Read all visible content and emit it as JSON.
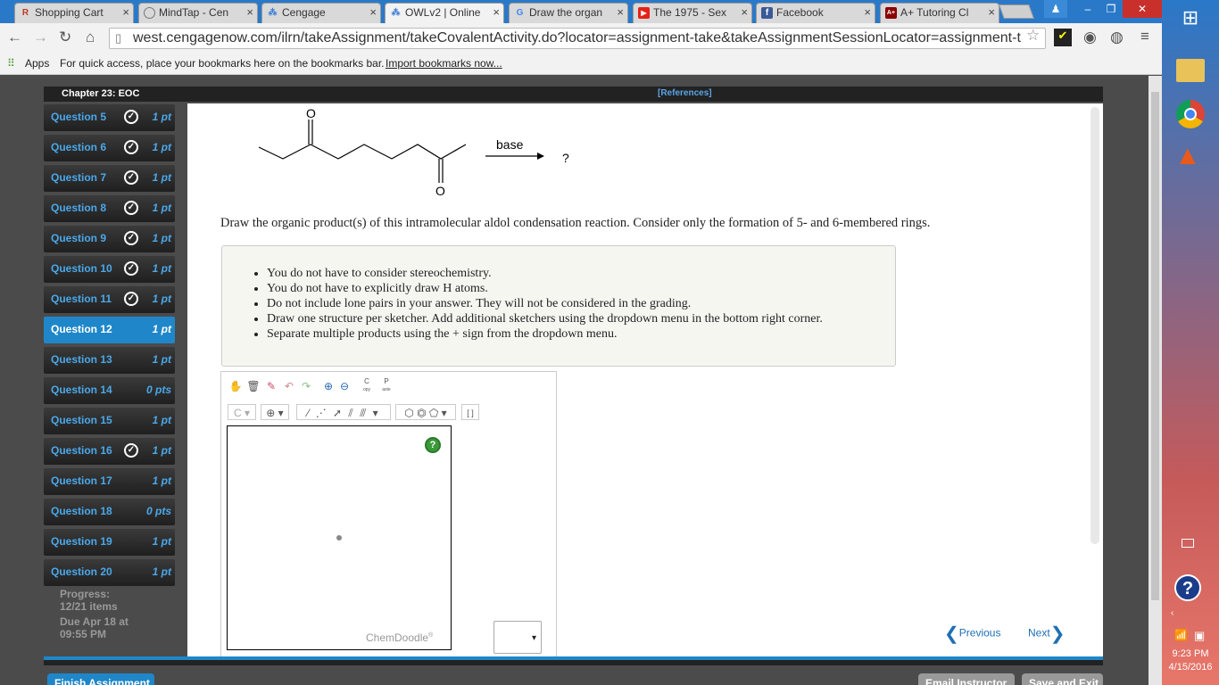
{
  "tabs": [
    {
      "label": "Shopping Cart",
      "icon": "R",
      "color": "#c0392b"
    },
    {
      "label": "MindTap - Cen",
      "icon": "mindtap-icon",
      "color": "#555"
    },
    {
      "label": "Cengage",
      "icon": "cengage-icon",
      "color": "#3a7bd5"
    },
    {
      "label": "OWLv2 | Online",
      "icon": "owl-icon",
      "color": "#3a7bd5"
    },
    {
      "label": "Draw the organ",
      "icon": "G",
      "color": "#4285f4"
    },
    {
      "label": "The 1975 - Sex",
      "icon": "youtube-icon",
      "color": "#e62117"
    },
    {
      "label": "Facebook",
      "icon": "f",
      "color": "#3b5998"
    },
    {
      "label": "A+ Tutoring Cl",
      "icon": "A+",
      "color": "#8b0000"
    }
  ],
  "url": "west.cengagenow.com/ilrn/takeAssignment/takeCovalentActivity.do?locator=assignment-take&takeAssignmentSessionLocator=assignment-t",
  "bookmarks": {
    "apps": "Apps",
    "hint": "For quick access, place your bookmarks here on the bookmarks bar.",
    "import": "Import bookmarks now..."
  },
  "chapter": {
    "title": "Chapter 23: EOC",
    "references": "[References]"
  },
  "questions": [
    {
      "label": "Question 5",
      "points": "1 pt",
      "done": true
    },
    {
      "label": "Question 6",
      "points": "1 pt",
      "done": true
    },
    {
      "label": "Question 7",
      "points": "1 pt",
      "done": true
    },
    {
      "label": "Question 8",
      "points": "1 pt",
      "done": true
    },
    {
      "label": "Question 9",
      "points": "1 pt",
      "done": true
    },
    {
      "label": "Question 10",
      "points": "1 pt",
      "done": true
    },
    {
      "label": "Question 11",
      "points": "1 pt",
      "done": true
    },
    {
      "label": "Question 12",
      "points": "1 pt",
      "done": false,
      "current": true
    },
    {
      "label": "Question 13",
      "points": "1 pt",
      "done": false
    },
    {
      "label": "Question 14",
      "points": "0 pts",
      "done": false
    },
    {
      "label": "Question 15",
      "points": "1 pt",
      "done": false
    },
    {
      "label": "Question 16",
      "points": "1 pt",
      "done": true
    },
    {
      "label": "Question 17",
      "points": "1 pt",
      "done": false
    },
    {
      "label": "Question 18",
      "points": "0 pts",
      "done": false
    },
    {
      "label": "Question 19",
      "points": "1 pt",
      "done": false
    },
    {
      "label": "Question 20",
      "points": "1 pt",
      "done": false
    }
  ],
  "progress": {
    "label": "Progress:",
    "items": "12/21 items",
    "due": "Due Apr 18 at",
    "time": "09:55 PM"
  },
  "reaction": {
    "reagent": "base",
    "product": "?",
    "oxygen_top": "O",
    "oxygen_bottom": "O"
  },
  "prompt": "Draw the organic product(s) of this intramolecular aldol condensation reaction. Consider only the formation of 5- and 6-membered rings.",
  "instructions": [
    "You do not have to consider stereochemistry.",
    "You do not have to explicitly draw H atoms.",
    "Do not include lone pairs in your answer. They will not be considered in the grading.",
    "Draw one structure per sketcher. Add additional sketchers using the dropdown menu in the bottom right corner.",
    "Separate multiple products using the + sign from the dropdown menu."
  ],
  "sketcher": {
    "brand": "ChemDoodle",
    "element": "C",
    "copy": "C",
    "paste": "P",
    "copy_sub": "opy",
    "paste_sub": "aste",
    "help": "?",
    "dropdown": "▾"
  },
  "nav": {
    "previous": "Previous",
    "next": "Next"
  },
  "buttons": {
    "finish": "Finish Assignment",
    "email": "Email Instructor",
    "save": "Save and Exit"
  },
  "clock": {
    "time": "9:23 PM",
    "date": "4/15/2016"
  }
}
